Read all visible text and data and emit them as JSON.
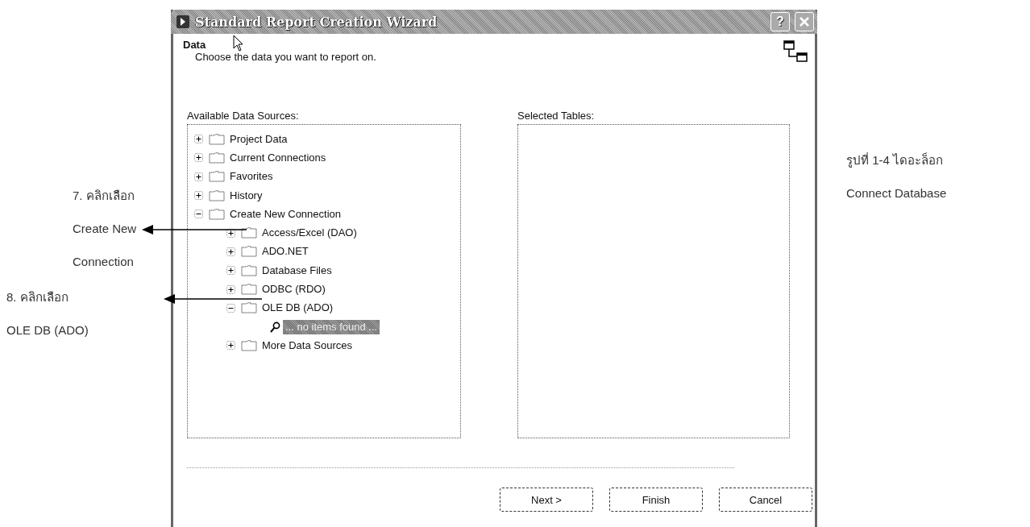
{
  "window": {
    "title": "Standard Report Creation Wizard",
    "help_button": "?"
  },
  "header": {
    "title": "Data",
    "subtitle": "Choose the data you want to report on."
  },
  "available": {
    "label": "Available Data Sources:",
    "tree": [
      {
        "label": "Project Data",
        "kind": "folder",
        "expanded": false,
        "selected": false
      },
      {
        "label": "Current Connections",
        "kind": "folder",
        "expanded": false,
        "selected": false
      },
      {
        "label": "Favorites",
        "kind": "folder",
        "expanded": false,
        "selected": false
      },
      {
        "label": "History",
        "kind": "folder",
        "expanded": false,
        "selected": false
      },
      {
        "label": "Create New Connection",
        "kind": "folder",
        "expanded": true,
        "selected": false,
        "children": [
          {
            "label": "Access/Excel (DAO)",
            "kind": "folder",
            "expanded": false,
            "selected": false
          },
          {
            "label": "ADO.NET",
            "kind": "folder",
            "expanded": false,
            "selected": false
          },
          {
            "label": "Database Files",
            "kind": "folder",
            "expanded": false,
            "selected": false
          },
          {
            "label": "ODBC (RDO)",
            "kind": "folder",
            "expanded": false,
            "selected": false
          },
          {
            "label": "OLE DB (ADO)",
            "kind": "folder",
            "expanded": true,
            "selected": false,
            "children": [
              {
                "label": "... no items found ...",
                "kind": "message",
                "selected": true
              }
            ]
          },
          {
            "label": "More Data Sources",
            "kind": "folder",
            "expanded": false,
            "selected": false
          }
        ]
      }
    ]
  },
  "selected_tables": {
    "label": "Selected Tables:"
  },
  "buttons": [
    {
      "label": "Next >"
    },
    {
      "label": "Finish"
    },
    {
      "label": "Cancel"
    }
  ],
  "annotations": [
    {
      "lines": [
        "7. คลิกเลือก",
        "Create New",
        "Connection"
      ]
    },
    {
      "lines": [
        "8. คลิกเลือก",
        "OLE DB (ADO)"
      ]
    }
  ],
  "caption": {
    "lines": [
      "รูปที่ 1-4 ไดอะล็อก",
      "Connect Database"
    ]
  }
}
